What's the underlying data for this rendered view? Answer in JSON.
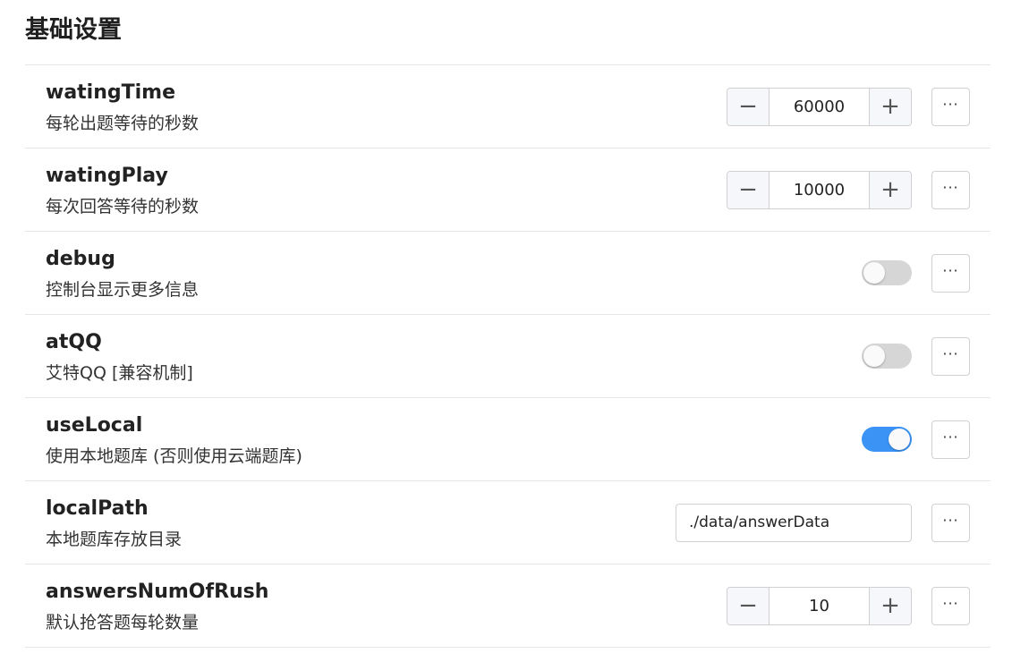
{
  "section": {
    "title": "基础设置"
  },
  "settings": [
    {
      "name": "watingTime",
      "desc": "每轮出题等待的秒数",
      "control": "stepper",
      "value": "60000",
      "minus_icon": "−",
      "plus_icon": "+",
      "more_icon": "···"
    },
    {
      "name": "watingPlay",
      "desc": "每次回答等待的秒数",
      "control": "stepper",
      "value": "10000",
      "minus_icon": "−",
      "plus_icon": "+",
      "more_icon": "···"
    },
    {
      "name": "debug",
      "desc": "控制台显示更多信息",
      "control": "toggle",
      "checked": false,
      "more_icon": "···"
    },
    {
      "name": "atQQ",
      "desc": "艾特QQ [兼容机制]",
      "control": "toggle",
      "checked": false,
      "more_icon": "···"
    },
    {
      "name": "useLocal",
      "desc": "使用本地题库 (否则使用云端题库)",
      "control": "toggle",
      "checked": true,
      "more_icon": "···"
    },
    {
      "name": "localPath",
      "desc": "本地题库存放目录",
      "control": "text",
      "value": "./data/answerData",
      "more_icon": "···"
    },
    {
      "name": "answersNumOfRush",
      "desc": "默认抢答题每轮数量",
      "control": "stepper",
      "value": "10",
      "minus_icon": "−",
      "plus_icon": "+",
      "more_icon": "···"
    }
  ],
  "colors": {
    "toggle_on": "#3a93f5",
    "toggle_off": "#d6d6d6",
    "divider": "#e6e6e6"
  }
}
